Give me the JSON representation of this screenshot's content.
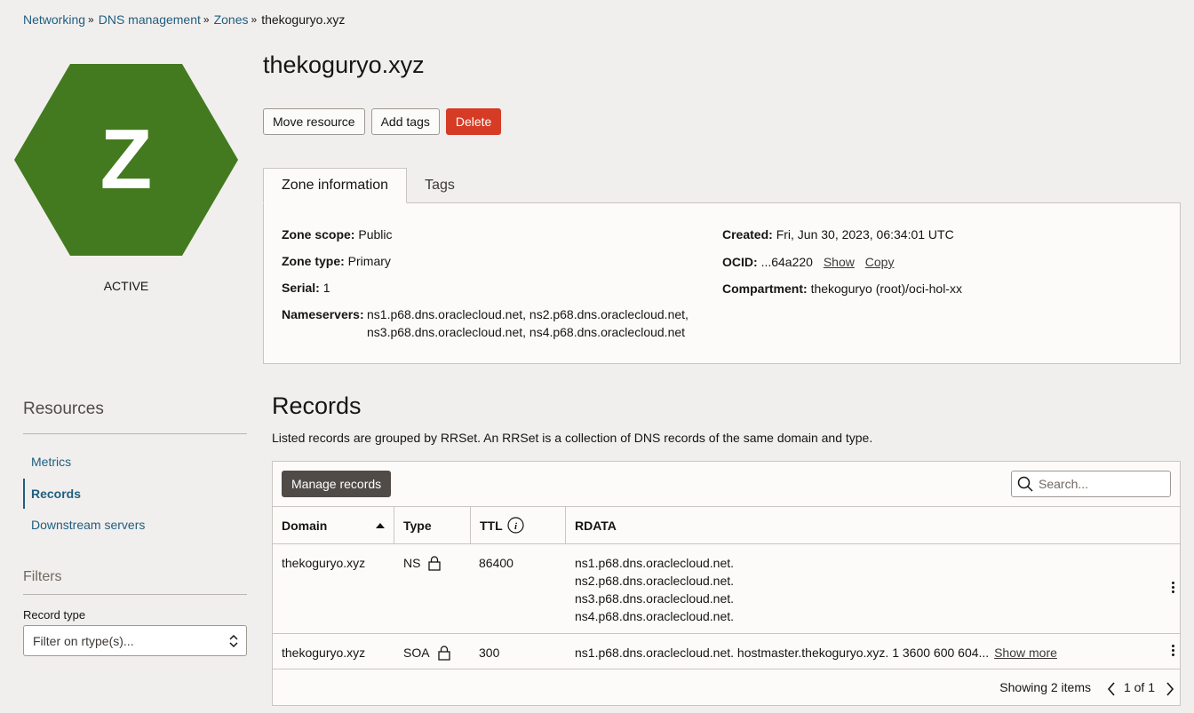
{
  "breadcrumb": {
    "items": [
      "Networking",
      "DNS management",
      "Zones"
    ],
    "current": "thekoguryo.xyz"
  },
  "hexagon": {
    "letter": "Z",
    "color": "#447a1f"
  },
  "status": "ACTIVE",
  "title": "thekoguryo.xyz",
  "actions": {
    "move": "Move resource",
    "add_tags": "Add tags",
    "delete": "Delete"
  },
  "tabs": [
    "Zone information",
    "Tags"
  ],
  "zone_info": {
    "scope_label": "Zone scope:",
    "scope": "Public",
    "type_label": "Zone type:",
    "type": "Primary",
    "serial_label": "Serial:",
    "serial": "1",
    "ns_label": "Nameservers:",
    "ns_line1": "ns1.p68.dns.oraclecloud.net, ns2.p68.dns.oraclecloud.net,",
    "ns_line2": "ns3.p68.dns.oraclecloud.net, ns4.p68.dns.oraclecloud.net",
    "created_label": "Created:",
    "created": "Fri, Jun 30, 2023, 06:34:01 UTC",
    "ocid_label": "OCID:",
    "ocid": "...64a220",
    "show": "Show",
    "copy": "Copy",
    "compartment_label": "Compartment:",
    "compartment": "thekoguryo (root)/oci-hol-xx"
  },
  "resources": {
    "title": "Resources",
    "items": [
      "Metrics",
      "Records",
      "Downstream servers"
    ],
    "active": "Records"
  },
  "filters": {
    "title": "Filters",
    "record_type_label": "Record type",
    "record_type_placeholder": "Filter on rtype(s)..."
  },
  "records": {
    "title": "Records",
    "description": "Listed records are grouped by RRSet. An RRSet is a collection of DNS records of the same domain and type.",
    "manage_button": "Manage records",
    "search_placeholder": "Search...",
    "columns": [
      "Domain",
      "Type",
      "TTL",
      "RDATA"
    ],
    "rows": [
      {
        "domain": "thekoguryo.xyz",
        "type": "NS",
        "ttl": "86400",
        "rdata": [
          "ns1.p68.dns.oraclecloud.net.",
          "ns2.p68.dns.oraclecloud.net.",
          "ns3.p68.dns.oraclecloud.net.",
          "ns4.p68.dns.oraclecloud.net."
        ]
      },
      {
        "domain": "thekoguryo.xyz",
        "type": "SOA",
        "ttl": "300",
        "rdata": [
          "ns1.p68.dns.oraclecloud.net. hostmaster.thekoguryo.xyz. 1 3600 600 604..."
        ],
        "show_more": "Show more"
      }
    ],
    "showing": "Showing 2 items",
    "page": "1 of 1"
  }
}
